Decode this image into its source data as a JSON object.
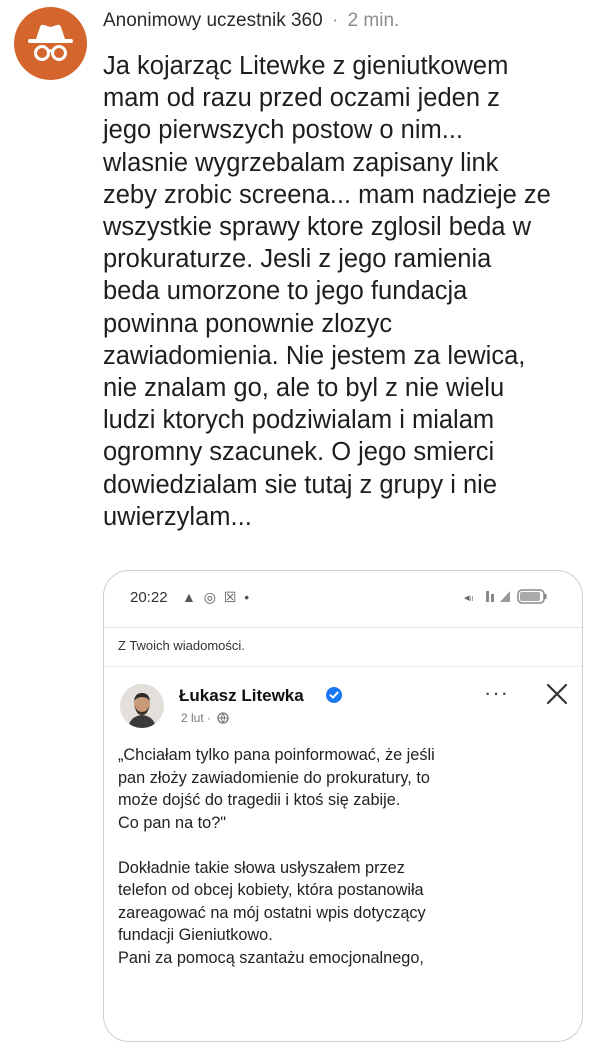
{
  "post": {
    "author": "Anonimowy uczestnik 360",
    "separator": "·",
    "time": "2 min.",
    "avatar_icon": "incognito-icon",
    "avatar_color": "#d4652c",
    "lines": [
      "Ja kojarząc Litewke z gieniutkowem",
      "mam od razu przed oczami jeden z",
      "jego pierwszych postow o nim...",
      "wlasnie wygrzebalam zapisany link",
      "zeby zrobic screena... mam nadzieje ze",
      "wszystkie sprawy ktore zglosil beda w",
      "prokuraturze. Jesli z jego ramienia",
      "beda umorzone to jego fundacja",
      "powinna ponownie zlozyc",
      "zawiadomienia. Nie jestem za lewica,",
      "nie znalam go, ale to byl z nie wielu",
      "ludzi ktorych podziwialam i mialam",
      "ogromny szacunek. O jego smierci",
      "dowiedzialam sie tutaj z grupy i nie",
      "uwierzylam..."
    ]
  },
  "screenshot": {
    "status_time": "20:22",
    "status_icons": "▲ ◎ ☒ •",
    "from_label": "Z Twoich wiadomości.",
    "sender_name": "Łukasz Litewka",
    "sender_date": "2 lut ·",
    "more_label": "···",
    "verified_color": "#1877f2",
    "message_lines": [
      "„Chciałam tylko pana poinformować, że jeśli",
      "pan złoży zawiadomienie do prokuratury, to",
      "może dojść do tragedii i ktoś się zabije.",
      "Co pan na to?\""
    ],
    "message_lines_2": [
      "Dokładnie takie słowa usłyszałem przez",
      "telefon od obcej kobiety, która postanowiła",
      "zareagować na mój ostatni wpis dotyczący",
      "fundacji Gieniutkowo.",
      "Pani za pomocą szantażu emocjonalnego,"
    ]
  }
}
